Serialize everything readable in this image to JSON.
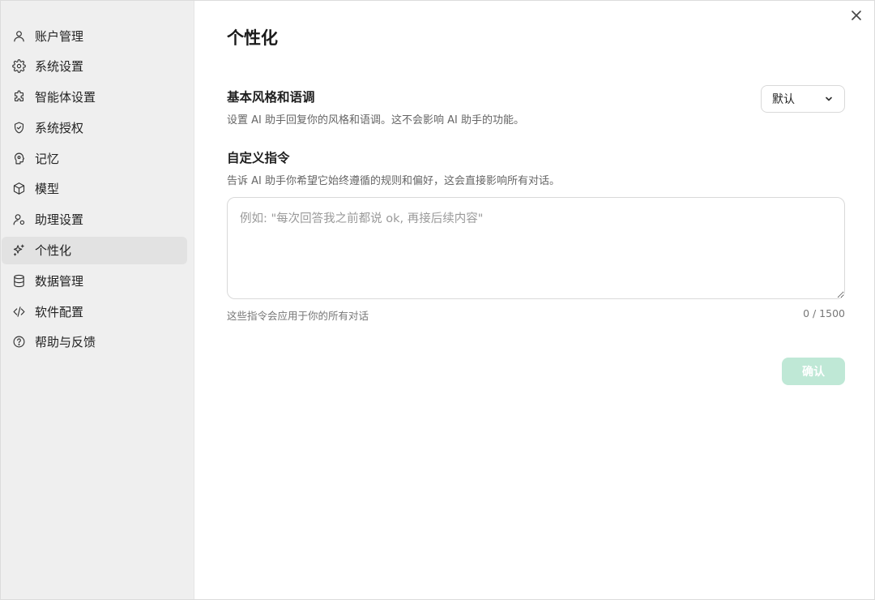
{
  "sidebar": {
    "items": [
      {
        "label": "账户管理",
        "icon": "user-icon"
      },
      {
        "label": "系统设置",
        "icon": "gear-icon"
      },
      {
        "label": "智能体设置",
        "icon": "puzzle-icon"
      },
      {
        "label": "系统授权",
        "icon": "shield-check-icon"
      },
      {
        "label": "记忆",
        "icon": "brain-head-icon"
      },
      {
        "label": "模型",
        "icon": "cube-icon"
      },
      {
        "label": "助理设置",
        "icon": "user-settings-icon"
      },
      {
        "label": "个性化",
        "icon": "sparkles-icon",
        "active": true
      },
      {
        "label": "数据管理",
        "icon": "database-icon"
      },
      {
        "label": "软件配置",
        "icon": "code-icon"
      },
      {
        "label": "帮助与反馈",
        "icon": "help-circle-icon"
      }
    ]
  },
  "main": {
    "title": "个性化",
    "style_section": {
      "title": "基本风格和语调",
      "description": "设置 AI 助手回复你的风格和语调。这不会影响 AI 助手的功能。",
      "select_value": "默认"
    },
    "instructions_section": {
      "title": "自定义指令",
      "description": "告诉 AI 助手你希望它始终遵循的规则和偏好，这会直接影响所有对话。",
      "placeholder": "例如: \"每次回答我之前都说 ok, 再接后续内容\"",
      "value": "",
      "hint": "这些指令会应用于你的所有对话",
      "counter": "0 / 1500"
    },
    "confirm_label": "确认"
  },
  "colors": {
    "sidebar_bg": "#efefef",
    "active_item_bg": "#e2e2e2",
    "confirm_disabled_bg": "#bfe8d6"
  }
}
